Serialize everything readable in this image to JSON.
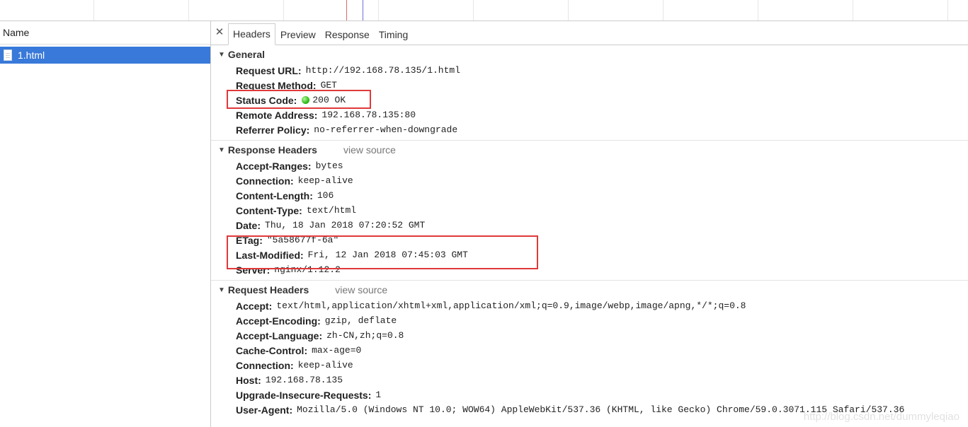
{
  "colors": {
    "selected_row": "#3879d9",
    "status_ok": "#2fbe19",
    "highlight_box": "#e0393a",
    "timeline_red": "#e06a6a",
    "timeline_blue": "#6e73d8"
  },
  "list": {
    "header": "Name",
    "items": [
      {
        "name": "1.html",
        "icon": "document-icon"
      }
    ]
  },
  "detail": {
    "close_icon": "close-icon",
    "tabs": [
      {
        "label": "Headers",
        "active": true
      },
      {
        "label": "Preview"
      },
      {
        "label": "Response"
      },
      {
        "label": "Timing"
      }
    ],
    "general": {
      "title": "General",
      "rows": [
        {
          "key": "Request URL:",
          "value": "http://192.168.78.135/1.html"
        },
        {
          "key": "Request Method:",
          "value": "GET"
        },
        {
          "key": "Status Code:",
          "value": "200 OK"
        },
        {
          "key": "Remote Address:",
          "value": "192.168.78.135:80"
        },
        {
          "key": "Referrer Policy:",
          "value": "no-referrer-when-downgrade"
        }
      ]
    },
    "response_headers": {
      "title": "Response Headers",
      "view_source": "view source",
      "rows": [
        {
          "key": "Accept-Ranges:",
          "value": "bytes"
        },
        {
          "key": "Connection:",
          "value": "keep-alive"
        },
        {
          "key": "Content-Length:",
          "value": "106"
        },
        {
          "key": "Content-Type:",
          "value": "text/html"
        },
        {
          "key": "Date:",
          "value": "Thu, 18 Jan 2018 07:20:52 GMT"
        },
        {
          "key": "ETag:",
          "value": "\"5a58677f-6a\""
        },
        {
          "key": "Last-Modified:",
          "value": "Fri, 12 Jan 2018 07:45:03 GMT"
        },
        {
          "key": "Server:",
          "value": "nginx/1.12.2"
        }
      ]
    },
    "request_headers": {
      "title": "Request Headers",
      "view_source": "view source",
      "rows": [
        {
          "key": "Accept:",
          "value": "text/html,application/xhtml+xml,application/xml;q=0.9,image/webp,image/apng,*/*;q=0.8"
        },
        {
          "key": "Accept-Encoding:",
          "value": "gzip, deflate"
        },
        {
          "key": "Accept-Language:",
          "value": "zh-CN,zh;q=0.8"
        },
        {
          "key": "Cache-Control:",
          "value": "max-age=0"
        },
        {
          "key": "Connection:",
          "value": "keep-alive"
        },
        {
          "key": "Host:",
          "value": "192.168.78.135"
        },
        {
          "key": "Upgrade-Insecure-Requests:",
          "value": "1"
        },
        {
          "key": "User-Agent:",
          "value": "Mozilla/5.0 (Windows NT 10.0; WOW64) AppleWebKit/537.36 (KHTML, like Gecko) Chrome/59.0.3071.115 Safari/537.36"
        }
      ]
    }
  },
  "watermark": "http://blog.csdn.net/dummyleqiao"
}
